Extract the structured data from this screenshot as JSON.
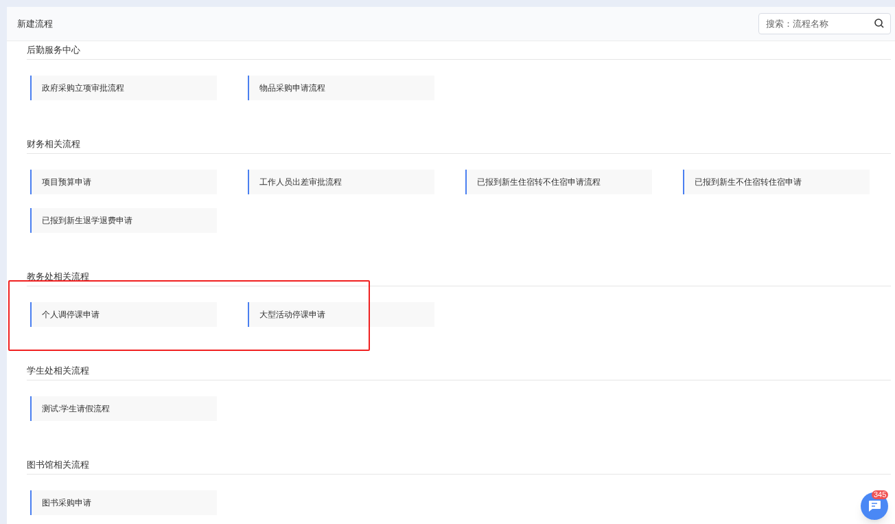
{
  "header": {
    "title": "新建流程",
    "search": {
      "placeholder": "搜索：流程名称"
    }
  },
  "sections": [
    {
      "title": "后勤服务中心",
      "highlighted": false,
      "items": [
        "政府采购立项审批流程",
        "物品采购申请流程"
      ]
    },
    {
      "title": "财务相关流程",
      "highlighted": false,
      "items": [
        "项目预算申请",
        "工作人员出差审批流程",
        "已报到新生住宿转不住宿申请流程",
        "已报到新生不住宿转住宿申请",
        "已报到新生退学退费申请"
      ]
    },
    {
      "title": "教务处相关流程",
      "highlighted": true,
      "items": [
        "个人调停课申请",
        "大型活动停课申请"
      ]
    },
    {
      "title": "学生处相关流程",
      "highlighted": false,
      "items": [
        "测试:学生请假流程"
      ]
    },
    {
      "title": "图书馆相关流程",
      "highlighted": false,
      "items": [
        "图书采购申请"
      ]
    }
  ],
  "chat": {
    "badge": "345"
  }
}
